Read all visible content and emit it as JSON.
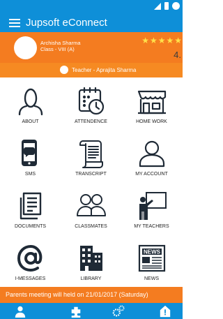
{
  "status_bar": {
    "icons": [
      "signal-icon",
      "battery-icon",
      "clock-icon"
    ]
  },
  "app_bar": {
    "menu_icon": "hamburger-menu-icon",
    "title": "Jupsoft eConnect"
  },
  "profile": {
    "student_name": "Archisha Sharma",
    "class": "Class - VIII (A)",
    "stars": "★★★★★",
    "rating": "4."
  },
  "teacher": {
    "text": "Teacher - Aprajita Sharma"
  },
  "menu": {
    "items": [
      {
        "label": "ABOUT",
        "icon": "person-outline-icon"
      },
      {
        "label": "ATTENDENCE",
        "icon": "calendar-clock-icon"
      },
      {
        "label": "HOME WORK",
        "icon": "storefront-icon"
      },
      {
        "label": "SMS",
        "icon": "phone-chat-icon"
      },
      {
        "label": "TRANSCRIPT",
        "icon": "scroll-document-icon"
      },
      {
        "label": "MY ACCOUNT",
        "icon": "user-account-icon"
      },
      {
        "label": "DOCUMENTS",
        "icon": "documents-icon"
      },
      {
        "label": "CLASSMATES",
        "icon": "group-people-icon"
      },
      {
        "label": "MY TEACHERS",
        "icon": "teacher-board-icon"
      },
      {
        "label": "I-MESSAGES",
        "icon": "at-sign-icon"
      },
      {
        "label": "LIBRARY",
        "icon": "library-building-icon"
      },
      {
        "label": "NEWS",
        "icon": "newspaper-icon"
      }
    ]
  },
  "notice": {
    "text": "Parents meeting will held on 21/01/2017 (Saturday)"
  },
  "bottom_nav": {
    "icons": [
      "person-nav-icon",
      "puzzle-icon",
      "gears-icon",
      "alert-home-icon"
    ]
  },
  "colors": {
    "blue": "#0e8fd8",
    "orange": "#f47c20",
    "icon": "#1f2a36"
  }
}
